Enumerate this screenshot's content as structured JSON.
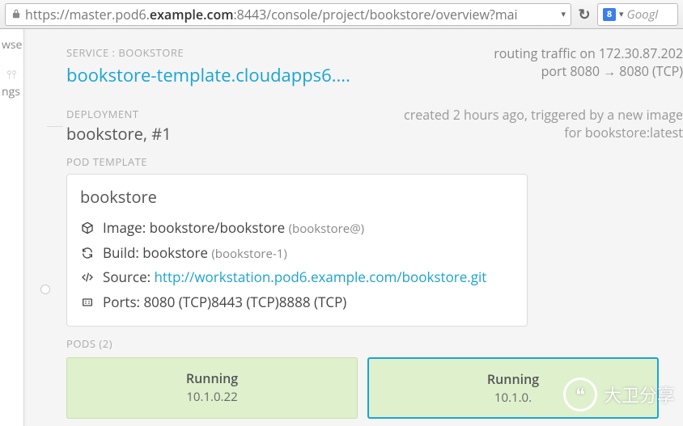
{
  "browser": {
    "url_prefix": "https://master.pod6.",
    "url_bold": "example.com",
    "url_suffix": ":8443/console/project/bookstore/overview?mai",
    "search_placeholder": "Googl"
  },
  "sidebar": {
    "items": [
      {
        "label": "wse"
      },
      {
        "label": "ngs"
      }
    ]
  },
  "service": {
    "label": "SERVICE : BOOKSTORE",
    "link": "bookstore-template.cloudapps6....",
    "routing_line1": "routing traffic on 172.30.87.202",
    "routing_line2": "port 8080 → 8080 (TCP)"
  },
  "deployment": {
    "label": "DEPLOYMENT",
    "title": "bookstore, #1",
    "created_line1": "created 2 hours ago, triggered by a new image",
    "created_line2": "for bookstore:latest"
  },
  "pod_template": {
    "label": "POD TEMPLATE",
    "title": "bookstore",
    "image_label": "Image:",
    "image_value": "bookstore/bookstore",
    "image_sub": "(bookstore@)",
    "build_label": "Build:",
    "build_value": "bookstore",
    "build_sub": "(bookstore-1)",
    "source_label": "Source:",
    "source_value": "http://workstation.pod6.example.com/bookstore.git",
    "ports_label": "Ports:",
    "ports_value": "8080 (TCP)8443 (TCP)8888 (TCP)"
  },
  "pods": {
    "label": "PODS (2)",
    "items": [
      {
        "status": "Running",
        "ip": "10.1.0.22"
      },
      {
        "status": "Running",
        "ip": "10.1.0."
      }
    ]
  },
  "watermark": {
    "text": "大卫分享"
  }
}
